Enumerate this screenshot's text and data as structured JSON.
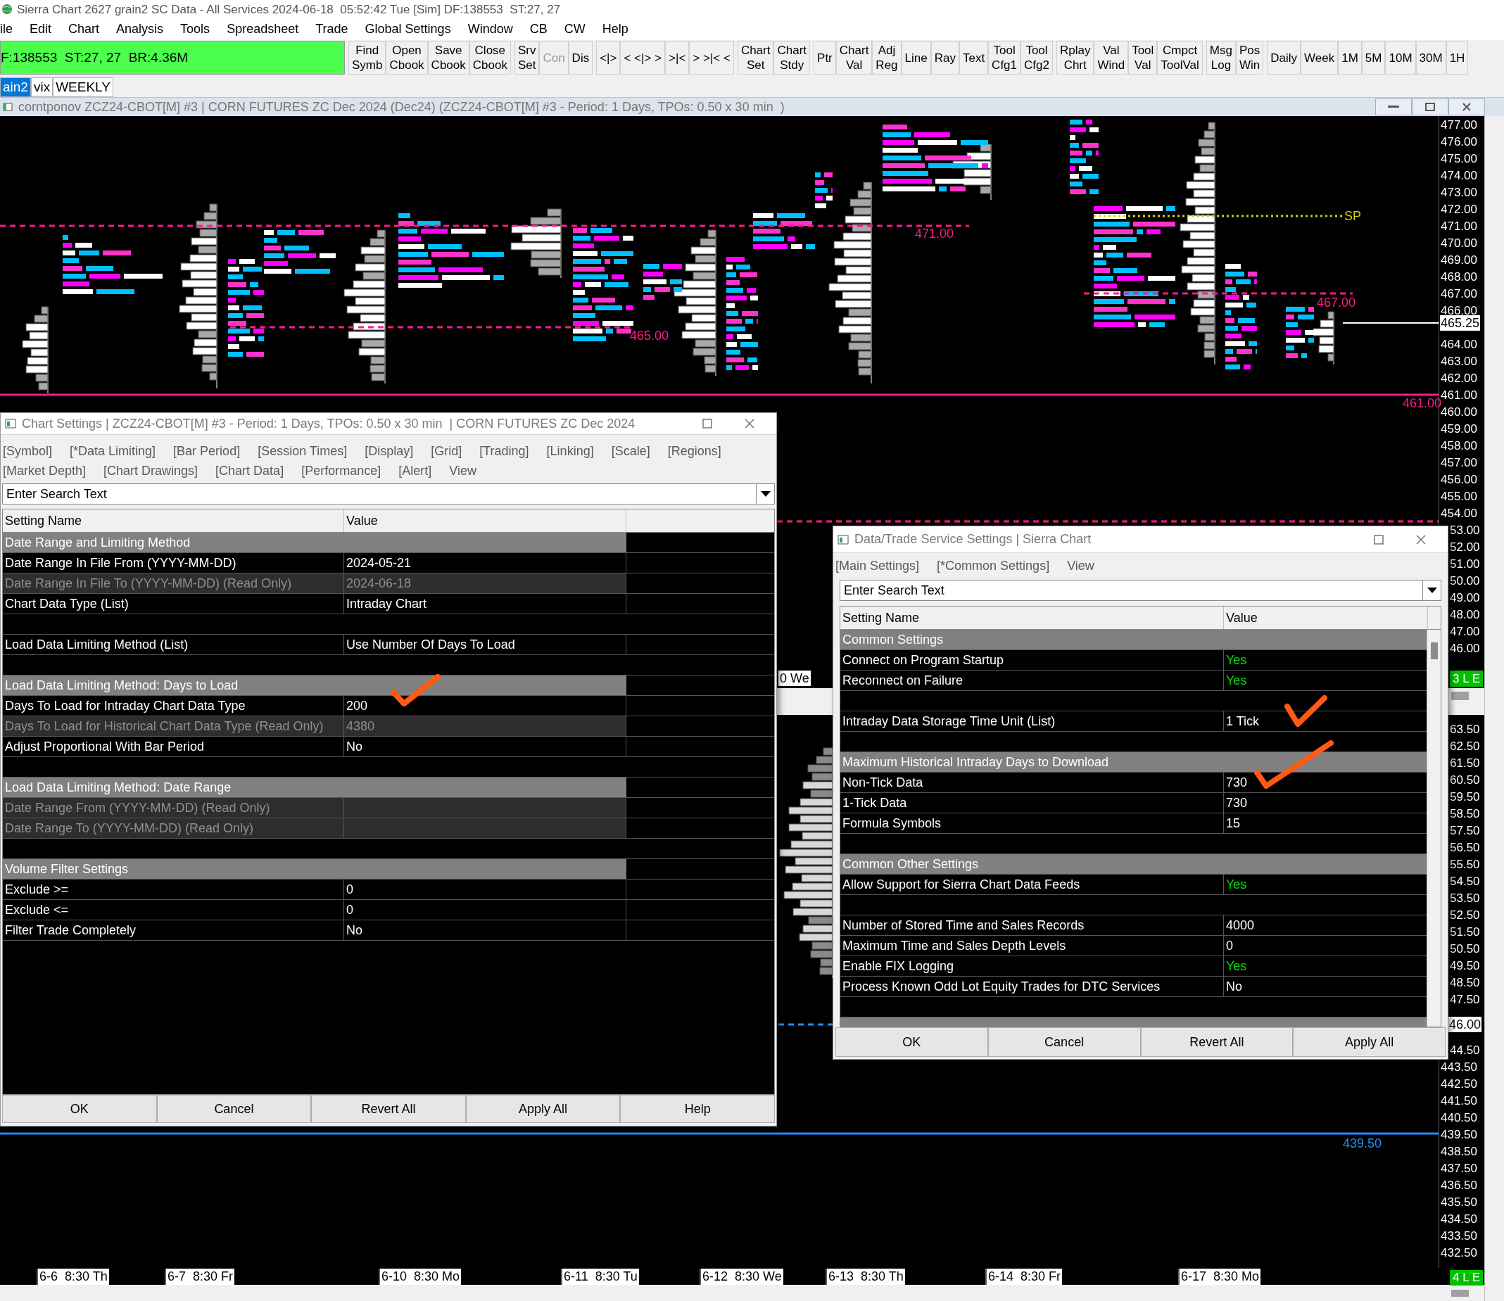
{
  "app": {
    "title": "Sierra Chart 2627 grain2 SC Data - All Services 2024-06-18  05:52:42 Tue [Sim] DF:138553  ST:27, 27"
  },
  "menu": [
    "ile",
    "Edit",
    "Chart",
    "Analysis",
    "Tools",
    "Spreadsheet",
    "Trade",
    "Global Settings",
    "Window",
    "CB",
    "CW",
    "Help"
  ],
  "toolbar": {
    "status": "F:138553  ST:27, 27  BR:4.36M",
    "groups": [
      [
        {
          "lines": [
            "Find",
            "Symb"
          ],
          "disabled": false
        },
        {
          "lines": [
            "Open",
            "Cbook"
          ],
          "disabled": false
        },
        {
          "lines": [
            "Save",
            "Cbook"
          ],
          "disabled": false
        },
        {
          "lines": [
            "Close",
            "Cbook"
          ],
          "disabled": false
        }
      ],
      [
        {
          "lines": [
            "Srv",
            "Set"
          ],
          "disabled": false
        },
        {
          "lines": [
            "Con"
          ],
          "disabled": true
        },
        {
          "lines": [
            "Dis"
          ],
          "disabled": false
        }
      ],
      [
        {
          "lines": [
            "<|>"
          ],
          "disabled": false
        },
        {
          "lines": [
            "< <|> >"
          ],
          "disabled": false
        },
        {
          "lines": [
            ">|<"
          ],
          "disabled": false
        },
        {
          "lines": [
            "> >|< <"
          ],
          "disabled": false
        }
      ],
      [
        {
          "lines": [
            "Chart",
            "Set"
          ],
          "disabled": false
        },
        {
          "lines": [
            "Chart",
            "Stdy"
          ],
          "disabled": false
        }
      ],
      [
        {
          "lines": [
            "Ptr"
          ],
          "disabled": false
        },
        {
          "lines": [
            "Chart",
            "Val"
          ],
          "disabled": false
        },
        {
          "lines": [
            "Adj",
            "Reg"
          ],
          "disabled": false
        },
        {
          "lines": [
            "Line"
          ],
          "disabled": false
        },
        {
          "lines": [
            "Ray"
          ],
          "disabled": false
        },
        {
          "lines": [
            "Text"
          ],
          "disabled": false
        },
        {
          "lines": [
            "Tool",
            "Cfg1"
          ],
          "disabled": false
        },
        {
          "lines": [
            "Tool",
            "Cfg2"
          ],
          "disabled": false
        }
      ],
      [
        {
          "lines": [
            "Rplay",
            "Chrt"
          ],
          "disabled": false
        },
        {
          "lines": [
            "Val",
            "Wind"
          ],
          "disabled": false
        },
        {
          "lines": [
            "Tool",
            "Val"
          ],
          "disabled": false
        },
        {
          "lines": [
            "Cmpct",
            "ToolVal"
          ],
          "disabled": false
        }
      ],
      [
        {
          "lines": [
            "Msg",
            "Log"
          ],
          "disabled": false
        },
        {
          "lines": [
            "Pos",
            "Win"
          ],
          "disabled": false
        }
      ],
      [
        {
          "lines": [
            "Daily"
          ],
          "disabled": false
        },
        {
          "lines": [
            "Week"
          ],
          "disabled": false
        },
        {
          "lines": [
            "1M"
          ],
          "disabled": false
        },
        {
          "lines": [
            "5M"
          ],
          "disabled": false
        },
        {
          "lines": [
            "10M"
          ],
          "disabled": false
        },
        {
          "lines": [
            "30M"
          ],
          "disabled": false
        },
        {
          "lines": [
            "1H"
          ],
          "disabled": false
        }
      ]
    ]
  },
  "chart_tabs": [
    {
      "label": "ain2",
      "selected": true
    },
    {
      "label": "vix",
      "selected": false
    },
    {
      "label": "WEEKLY",
      "selected": false
    }
  ],
  "chart": {
    "title": "corntponov ZCZ24-CBOT[M] #3 | CORN FUTURES ZC Dec 2024 (Dec24) (ZCZ24-CBOT[M] #3 - Period: 1 Days, TPOs: 0.50 x 30 min  )",
    "upper_axis": [
      "477.00",
      "476.00",
      "475.00",
      "474.00",
      "473.00",
      "472.00",
      "471.00",
      "470.00",
      "469.00",
      "468.00",
      "467.00",
      "466.00",
      "464.00",
      "463.00",
      "462.00",
      "461.00",
      "460.00",
      "459.00",
      "458.00",
      "457.00",
      "456.00",
      "455.00",
      "454.00",
      "53.00",
      "52.00",
      "51.00",
      "50.00",
      "49.00",
      "48.00",
      "47.00",
      "46.00"
    ],
    "current_price": "465.25",
    "lower_axis": [
      "63.50",
      "62.50",
      "61.50",
      "60.50",
      "59.50",
      "58.50",
      "57.50",
      "56.50",
      "55.50",
      "54.50",
      "53.50",
      "52.50",
      "51.50",
      "50.50",
      "49.50",
      "48.50",
      "47.50",
      "44.50",
      "443.50",
      "442.50",
      "441.50",
      "440.50",
      "439.50",
      "438.50",
      "437.50",
      "436.50",
      "435.50",
      "434.50",
      "433.50",
      "432.50"
    ],
    "lower_marker": "46.00",
    "levels": [
      {
        "label": "471.00",
        "kind": "dashed",
        "color": "#ff1a8c"
      },
      {
        "label": "SP",
        "kind": "dotted",
        "color": "#d4d400"
      },
      {
        "label": "467.00",
        "kind": "dashed",
        "color": "#ff1a8c"
      },
      {
        "label": "465.00",
        "kind": "dashed",
        "color": "#ff1a8c"
      },
      {
        "label": "461.00",
        "kind": "solid",
        "color": "#ff1a8c"
      },
      {
        "label": "439.50",
        "kind": "solid",
        "color": "#1e90ff"
      }
    ],
    "upper_time_label": "0 We",
    "upper_status": "3 L E",
    "time_axis": [
      "6-6  8:30 Th",
      "6-7  8:30 Fr",
      "6-10  8:30 Mo",
      "6-11  8:30 Tu",
      "6-12  8:30 We",
      "6-13  8:30 Th",
      "6-14  8:30 Fr",
      "6-17  8:30 Mo"
    ],
    "lower_status": "4 L E"
  },
  "chart_settings": {
    "title": "Chart Settings | ZCZ24-CBOT[M] #3 - Period: 1 Days, TPOs: 0.50 x 30 min  | CORN FUTURES ZC Dec 2024",
    "tabs": [
      [
        "[Symbol]",
        "[*Data Limiting]",
        "[Bar Period]",
        "[Session Times]",
        "[Display]",
        "[Grid]",
        "[Trading]",
        "[Linking]",
        "[Scale]",
        "[Regions]"
      ],
      [
        "[Market Depth]",
        "[Chart Drawings]",
        "[Chart Data]",
        "[Performance]",
        "[Alert]",
        "View"
      ]
    ],
    "search": {
      "placeholder": "Enter Search Text"
    },
    "columns": [
      "Setting Name",
      "Value"
    ],
    "rows": [
      {
        "kind": "section",
        "label": "Date Range and Limiting Method"
      },
      {
        "kind": "setting",
        "name": "Date Range In File From (YYYY-MM-DD)",
        "value": "2024-05-21",
        "read_only": false
      },
      {
        "kind": "setting",
        "name": "Date Range In File To (YYYY-MM-DD) (Read Only)",
        "value": "2024-06-18",
        "read_only": true
      },
      {
        "kind": "setting",
        "name": "Chart Data Type (List)",
        "value": "Intraday Chart",
        "read_only": false
      },
      {
        "kind": "blank"
      },
      {
        "kind": "setting",
        "name": "Load Data Limiting Method (List)",
        "value": "Use Number Of Days To Load",
        "read_only": false
      },
      {
        "kind": "blank"
      },
      {
        "kind": "section",
        "label": "Load Data Limiting Method: Days to Load"
      },
      {
        "kind": "setting",
        "name": "Days To Load for Intraday Chart Data Type",
        "value": "200",
        "read_only": false
      },
      {
        "kind": "setting",
        "name": "Days To Load for Historical Chart Data Type (Read Only)",
        "value": "4380",
        "read_only": true
      },
      {
        "kind": "setting",
        "name": "Adjust Proportional With Bar Period",
        "value": "No",
        "read_only": false
      },
      {
        "kind": "blank"
      },
      {
        "kind": "section",
        "label": "Load Data Limiting Method: Date Range"
      },
      {
        "kind": "setting",
        "name": "Date Range From (YYYY-MM-DD) (Read Only)",
        "read_only": true
      },
      {
        "kind": "setting",
        "name": "Date Range To (YYYY-MM-DD) (Read Only)",
        "read_only": true
      },
      {
        "kind": "blank"
      },
      {
        "kind": "section",
        "label": "Volume Filter Settings"
      },
      {
        "kind": "setting",
        "name": "Exclude >=",
        "value": "0",
        "read_only": false
      },
      {
        "kind": "setting",
        "name": "Exclude <=",
        "value": "0",
        "read_only": false
      },
      {
        "kind": "setting",
        "name": "Filter Trade Completely",
        "value": "No",
        "read_only": false
      }
    ],
    "buttons": [
      "OK",
      "Cancel",
      "Revert All",
      "Apply All",
      "Help"
    ]
  },
  "service_settings": {
    "title": "Data/Trade Service Settings | Sierra Chart",
    "tabs": [
      [
        "[Main Settings]",
        "[*Common Settings]",
        "View"
      ]
    ],
    "search": {
      "placeholder": "Enter Search Text"
    },
    "columns": [
      "Setting Name",
      "Value"
    ],
    "rows": [
      {
        "kind": "section",
        "label": "Common Settings"
      },
      {
        "kind": "setting",
        "name": "Connect on Program Startup",
        "value": "Yes",
        "read_only": false,
        "highlight": true
      },
      {
        "kind": "setting",
        "name": "Reconnect on Failure",
        "value": "Yes",
        "read_only": false,
        "highlight": true
      },
      {
        "kind": "blank"
      },
      {
        "kind": "setting",
        "name": "Intraday Data Storage Time Unit (List)",
        "value": "1 Tick",
        "read_only": false,
        "highlight": false
      },
      {
        "kind": "blank"
      },
      {
        "kind": "section",
        "label": "Maximum Historical Intraday Days to Download"
      },
      {
        "kind": "setting",
        "name": "Non-Tick Data",
        "value": "730",
        "read_only": false,
        "highlight": false
      },
      {
        "kind": "setting",
        "name": "1-Tick Data",
        "value": "730",
        "read_only": false,
        "highlight": false
      },
      {
        "kind": "setting",
        "name": "Formula Symbols",
        "value": "15",
        "read_only": false,
        "highlight": false
      },
      {
        "kind": "blank"
      },
      {
        "kind": "section",
        "label": "Common Other Settings"
      },
      {
        "kind": "setting",
        "name": "Allow Support for Sierra Chart Data Feeds",
        "value": "Yes",
        "read_only": false,
        "highlight": true
      },
      {
        "kind": "blank"
      },
      {
        "kind": "setting",
        "name": "Number of Stored Time and Sales Records",
        "value": "4000",
        "read_only": false,
        "highlight": false
      },
      {
        "kind": "setting",
        "name": "Maximum Time and Sales Depth Levels",
        "value": "0",
        "read_only": false,
        "highlight": false
      },
      {
        "kind": "setting",
        "name": "Enable FIX Logging",
        "value": "Yes",
        "read_only": false,
        "highlight": true
      },
      {
        "kind": "setting",
        "name": "Process Known Odd Lot Equity Trades for DTC Services",
        "value": "No",
        "read_only": false,
        "highlight": false
      },
      {
        "kind": "blank"
      }
    ],
    "buttons": [
      "OK",
      "Cancel",
      "Revert All",
      "Apply All"
    ]
  }
}
